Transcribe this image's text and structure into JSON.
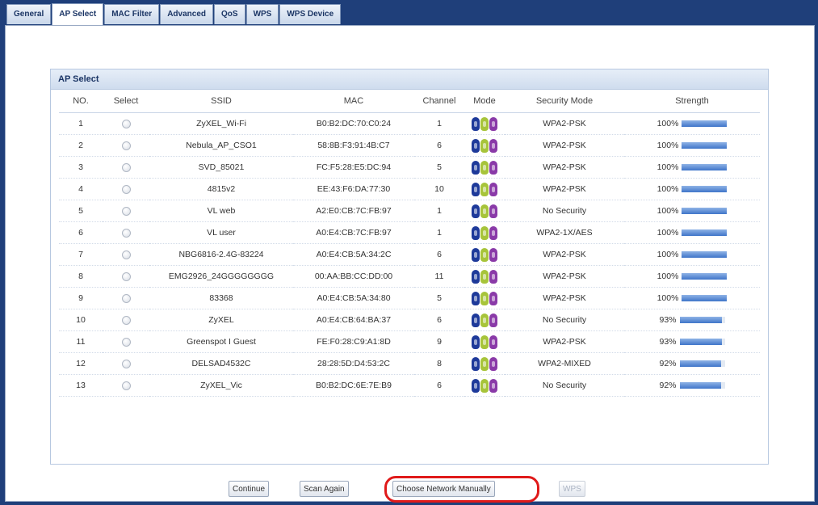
{
  "tabs": [
    "General",
    "AP Select",
    "MAC Filter",
    "Advanced",
    "QoS",
    "WPS",
    "WPS Device"
  ],
  "active_tab": "AP Select",
  "panel": {
    "title": "AP Select"
  },
  "table": {
    "headers": [
      "NO.",
      "Select",
      "SSID",
      "MAC",
      "Channel",
      "Mode",
      "Security Mode",
      "Strength"
    ],
    "rows": [
      {
        "no": "1",
        "ssid": "ZyXEL_Wi-Fi",
        "mac": "B0:B2:DC:70:C0:24",
        "channel": "1",
        "security": "WPA2-PSK",
        "strength": "100%",
        "level": 1.0
      },
      {
        "no": "2",
        "ssid": "Nebula_AP_CSO1",
        "mac": "58:8B:F3:91:4B:C7",
        "channel": "6",
        "security": "WPA2-PSK",
        "strength": "100%",
        "level": 1.0
      },
      {
        "no": "3",
        "ssid": "SVD_85021",
        "mac": "FC:F5:28:E5:DC:94",
        "channel": "5",
        "security": "WPA2-PSK",
        "strength": "100%",
        "level": 1.0
      },
      {
        "no": "4",
        "ssid": "4815v2",
        "mac": "EE:43:F6:DA:77:30",
        "channel": "10",
        "security": "WPA2-PSK",
        "strength": "100%",
        "level": 1.0
      },
      {
        "no": "5",
        "ssid": "VL web",
        "mac": "A2:E0:CB:7C:FB:97",
        "channel": "1",
        "security": "No Security",
        "strength": "100%",
        "level": 1.0
      },
      {
        "no": "6",
        "ssid": "VL user",
        "mac": "A0:E4:CB:7C:FB:97",
        "channel": "1",
        "security": "WPA2-1X/AES",
        "strength": "100%",
        "level": 1.0
      },
      {
        "no": "7",
        "ssid": "NBG6816-2.4G-83224",
        "mac": "A0:E4:CB:5A:34:2C",
        "channel": "6",
        "security": "WPA2-PSK",
        "strength": "100%",
        "level": 1.0
      },
      {
        "no": "8",
        "ssid": "EMG2926_24GGGGGGGG",
        "mac": "00:AA:BB:CC:DD:00",
        "channel": "11",
        "security": "WPA2-PSK",
        "strength": "100%",
        "level": 1.0
      },
      {
        "no": "9",
        "ssid": "83368",
        "mac": "A0:E4:CB:5A:34:80",
        "channel": "5",
        "security": "WPA2-PSK",
        "strength": "100%",
        "level": 1.0
      },
      {
        "no": "10",
        "ssid": "ZyXEL",
        "mac": "A0:E4:CB:64:BA:37",
        "channel": "6",
        "security": "No Security",
        "strength": "93%",
        "level": 0.93
      },
      {
        "no": "11",
        "ssid": "Greenspot I Guest",
        "mac": "FE:F0:28:C9:A1:8D",
        "channel": "9",
        "security": "WPA2-PSK",
        "strength": "93%",
        "level": 0.93
      },
      {
        "no": "12",
        "ssid": "DELSAD4532C",
        "mac": "28:28:5D:D4:53:2C",
        "channel": "8",
        "security": "WPA2-MIXED",
        "strength": "92%",
        "level": 0.92
      },
      {
        "no": "13",
        "ssid": "ZyXEL_Vic",
        "mac": "B0:B2:DC:6E:7E:B9",
        "channel": "6",
        "security": "No Security",
        "strength": "92%",
        "level": 0.92
      }
    ]
  },
  "mode_icons": [
    "mode-b-icon",
    "mode-g-icon",
    "mode-n-icon"
  ],
  "buttons": {
    "continue": "Continue",
    "scan_again": "Scan Again",
    "choose_manually": "Choose Network Manually",
    "wps": "WPS"
  },
  "colors": {
    "highlight": "#e01a1a",
    "frame": "#1f3f7a",
    "strength_bar": "#3f75c9"
  }
}
